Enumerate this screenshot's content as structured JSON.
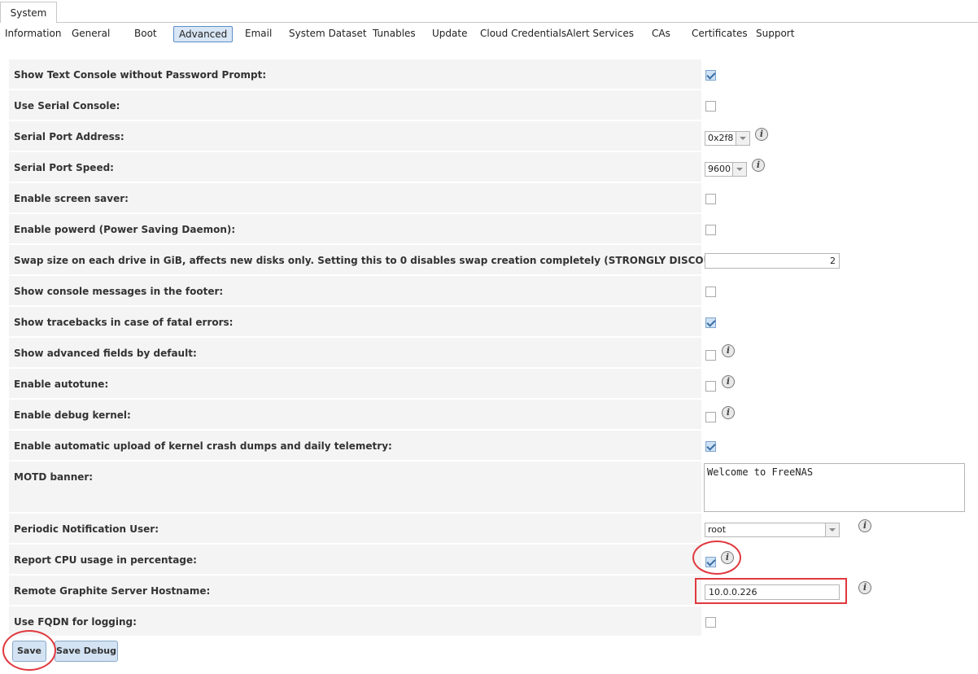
{
  "top_tab": {
    "label": "System"
  },
  "subnav": {
    "tabs": [
      {
        "label": "Information"
      },
      {
        "label": "General"
      },
      {
        "label": "Boot"
      },
      {
        "label": "Advanced"
      },
      {
        "label": "Email"
      },
      {
        "label": "System Dataset"
      },
      {
        "label": "Tunables"
      },
      {
        "label": "Update"
      },
      {
        "label": "Cloud Credentials"
      },
      {
        "label": "Alert Services"
      },
      {
        "label": "CAs"
      },
      {
        "label": "Certificates"
      },
      {
        "label": "Support"
      }
    ],
    "active": "Advanced"
  },
  "form": {
    "rows": [
      {
        "label": "Show Text Console without Password Prompt:",
        "type": "checkbox",
        "checked": true
      },
      {
        "label": "Use Serial Console:",
        "type": "checkbox",
        "checked": false
      },
      {
        "label": "Serial Port Address:",
        "type": "select",
        "value": "0x2f8",
        "info": true
      },
      {
        "label": "Serial Port Speed:",
        "type": "select",
        "value": "9600",
        "info": true
      },
      {
        "label": "Enable screen saver:",
        "type": "checkbox",
        "checked": false
      },
      {
        "label": "Enable powerd (Power Saving Daemon):",
        "type": "checkbox",
        "checked": false
      },
      {
        "label": "Swap size on each drive in GiB, affects new disks only. Setting this to 0 disables swap creation completely (STRONGLY DISCOURAGED).",
        "type": "input",
        "value": "2"
      },
      {
        "label": "Show console messages in the footer:",
        "type": "checkbox",
        "checked": false
      },
      {
        "label": "Show tracebacks in case of fatal errors:",
        "type": "checkbox",
        "checked": true
      },
      {
        "label": "Show advanced fields by default:",
        "type": "checkbox",
        "checked": false,
        "info": true
      },
      {
        "label": "Enable autotune:",
        "type": "checkbox",
        "checked": false,
        "info": true
      },
      {
        "label": "Enable debug kernel:",
        "type": "checkbox",
        "checked": false,
        "info": true
      },
      {
        "label": "Enable automatic upload of kernel crash dumps and daily telemetry:",
        "type": "checkbox",
        "checked": true
      },
      {
        "label": "MOTD banner:",
        "type": "textarea",
        "value": "Welcome to FreeNAS"
      },
      {
        "label": "Periodic Notification User:",
        "type": "select",
        "value": "root",
        "info": true
      },
      {
        "label": "Report CPU usage in percentage:",
        "type": "checkbox",
        "checked": true,
        "info": true
      },
      {
        "label": "Remote Graphite Server Hostname:",
        "type": "input",
        "value": "10.0.0.226",
        "info": true
      },
      {
        "label": "Use FQDN for logging:",
        "type": "checkbox",
        "checked": false
      }
    ]
  },
  "buttons": {
    "save": "Save",
    "save_debug": "Save Debug"
  },
  "icons": {
    "info": "info-icon",
    "info_glyph": "i"
  },
  "colors": {
    "accent": "#5c8fc7",
    "highlight": "#e0393e",
    "row_bg": "#f4f4f4",
    "button_bg": "#d3e3f3"
  }
}
